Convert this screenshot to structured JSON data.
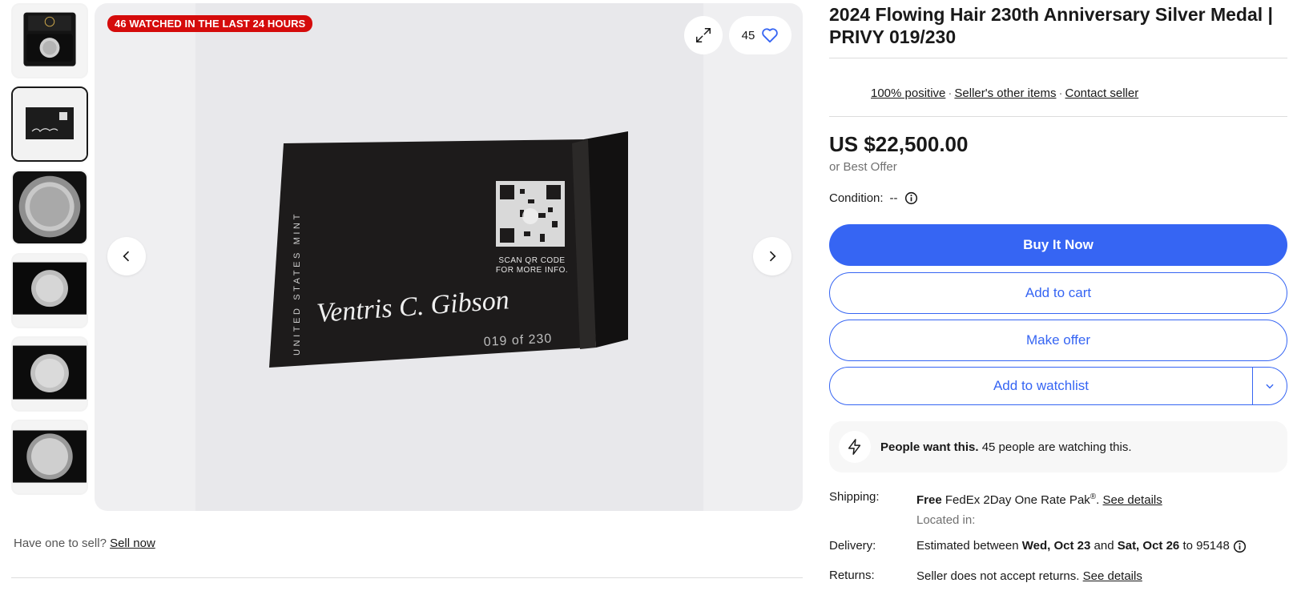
{
  "colors": {
    "accent": "#3665f3",
    "banner_red": "#d50b0b",
    "text": "#191919",
    "muted": "#707070"
  },
  "gallery": {
    "watch_banner": "46 WATCHED IN THE LAST 24 HOURS",
    "watch_count": "45",
    "thumbnails": [
      {
        "subject": "medal in display case"
      },
      {
        "subject": "signed certificate card"
      },
      {
        "subject": "medal in capsule"
      },
      {
        "subject": "medal in black box"
      },
      {
        "subject": "medal in black box"
      },
      {
        "subject": "medal in capsule"
      }
    ],
    "active_thumbnail": 1,
    "photo": {
      "card_vertical_text": "UNITED STATES MINT",
      "qr_caption_line1": "SCAN QR CODE",
      "qr_caption_line2": "FOR MORE INFO.",
      "signature": "Ventris C. Gibson",
      "serial": "019 of 230"
    }
  },
  "sell": {
    "prompt": "Have one to sell?",
    "link": "Sell now"
  },
  "listing": {
    "title": "2024 Flowing Hair 230th Anniversary Silver Medal | PRIVY 019/230",
    "seller_links": [
      "100% positive",
      "Seller's other items",
      "Contact seller"
    ],
    "price": "US $22,500.00",
    "best_offer": "or Best Offer",
    "condition_label": "Condition:",
    "condition_value": "--",
    "buttons": {
      "buy_now": "Buy It Now",
      "add_to_cart": "Add to cart",
      "make_offer": "Make offer",
      "watchlist": "Add to watchlist"
    },
    "demand": {
      "bold": "People want this.",
      "text": "45 people are watching this."
    },
    "shipping": {
      "label": "Shipping:",
      "free": "Free",
      "service": "FedEx 2Day One Rate Pak",
      "reg": "®",
      "period": ".",
      "details_link": "See details",
      "located": "Located in:"
    },
    "delivery": {
      "label": "Delivery:",
      "prefix": "Estimated between",
      "date1": "Wed, Oct 23",
      "and": "and",
      "date2": "Sat, Oct 26",
      "to": "to",
      "zip": "95148"
    },
    "returns": {
      "label": "Returns:",
      "text": "Seller does not accept returns.",
      "details_link": "See details"
    }
  }
}
